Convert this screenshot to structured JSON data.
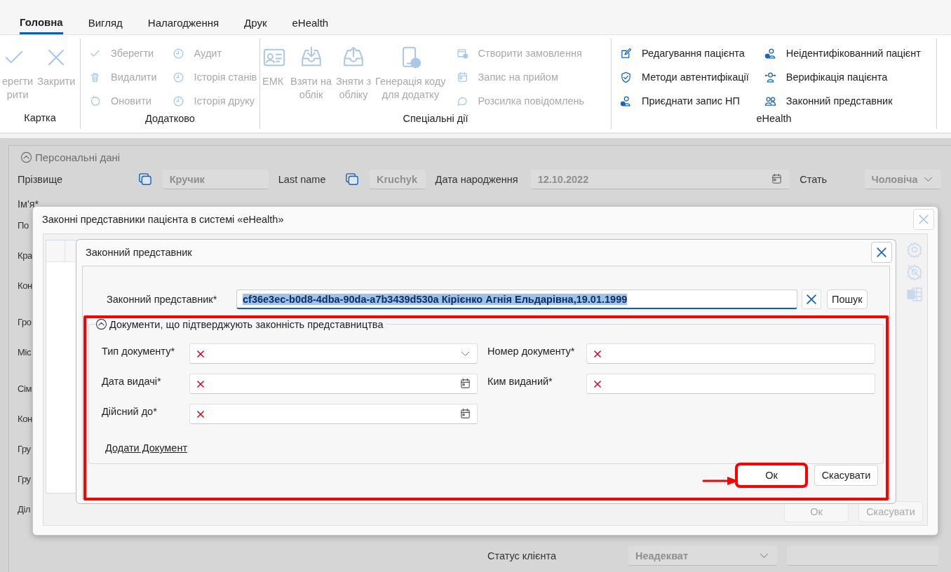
{
  "tabs": [
    {
      "label": "Головна",
      "selected": true
    },
    {
      "label": "Вигляд",
      "selected": false
    },
    {
      "label": "Налагодження",
      "selected": false
    },
    {
      "label": "Друк",
      "selected": false
    },
    {
      "label": "eHealth",
      "selected": false
    }
  ],
  "ribbon": {
    "groups": [
      {
        "title": "Картка",
        "items": [
          {
            "kind": "large",
            "lines": [
              "ерегти",
              "рити"
            ],
            "disabled": true
          },
          {
            "kind": "large",
            "lines": [
              "Закрити"
            ],
            "disabled": true
          }
        ]
      },
      {
        "title": "Додатково",
        "items": [
          {
            "kind": "small",
            "lines": [
              "Зберегти"
            ],
            "disabled": true
          },
          {
            "kind": "small",
            "lines": [
              "Видалити"
            ],
            "disabled": true
          },
          {
            "kind": "small",
            "lines": [
              "Оновити"
            ],
            "disabled": true
          },
          {
            "kind": "small",
            "lines": [
              "Аудит"
            ],
            "disabled": true
          },
          {
            "kind": "small",
            "lines": [
              "Історія станів"
            ],
            "disabled": true
          },
          {
            "kind": "small",
            "lines": [
              "Історія друку"
            ],
            "disabled": true
          }
        ]
      },
      {
        "title": "Спеціальні дії",
        "items": [
          {
            "kind": "large",
            "lines": [
              "ЕМК"
            ],
            "disabled": true
          },
          {
            "kind": "large",
            "lines": [
              "Взяти на",
              "облік"
            ],
            "disabled": true
          },
          {
            "kind": "large",
            "lines": [
              "Зняти з",
              "обліку"
            ],
            "disabled": true
          },
          {
            "kind": "large",
            "lines": [
              "Генерація коду",
              "для додатку"
            ],
            "disabled": true
          },
          {
            "kind": "small",
            "lines": [
              "Створити замовлення"
            ],
            "disabled": true
          },
          {
            "kind": "small",
            "lines": [
              "Запис на прийом"
            ],
            "disabled": true
          },
          {
            "kind": "small",
            "lines": [
              "Розсилка повідомлень"
            ],
            "disabled": true
          }
        ]
      },
      {
        "title": "eHealth",
        "items": [
          {
            "kind": "small",
            "lines": [
              "Редагування пацієнта"
            ],
            "disabled": false
          },
          {
            "kind": "small",
            "lines": [
              "Методи автентифікації"
            ],
            "disabled": false
          },
          {
            "kind": "small",
            "lines": [
              "Приєднати запис НП"
            ],
            "disabled": false
          },
          {
            "kind": "small",
            "lines": [
              "Неідентифікованний пацієнт"
            ],
            "disabled": false
          },
          {
            "kind": "small",
            "lines": [
              "Верифікація пацієнта"
            ],
            "disabled": false
          },
          {
            "kind": "small",
            "lines": [
              "Законний представник"
            ],
            "disabled": false
          }
        ]
      }
    ]
  },
  "personal_section": {
    "title": "Персональні дані",
    "expanded": true,
    "row_1": [
      {
        "label": "Прізвище",
        "kind": "copy-text",
        "value": "Кручик"
      },
      {
        "label": "Last name",
        "kind": "copy-text",
        "value": "Kruchyk"
      },
      {
        "label": "Дата народження",
        "kind": "date",
        "value": "12.10.2022"
      },
      {
        "label": "Стать",
        "kind": "dropdown",
        "value": "Чоловіча"
      }
    ],
    "row_2_labels": [
      "Ім'я*"
    ],
    "left_labels": [
      "По",
      "Кра",
      "Кон",
      "Гро",
      "Міс",
      "Сім",
      "Кон",
      "Гру",
      "Гру",
      "Діл"
    ],
    "client_status": {
      "label": "Статус клієнта",
      "value": "Неадекват"
    }
  },
  "representatives_dialog": {
    "title": "Законні представники пацієнта в системі «eHealth»",
    "table": {
      "header_visible": true
    },
    "buttons": [
      {
        "label": "Ок",
        "disabled": true
      },
      {
        "label": "Скасувати",
        "disabled": true
      }
    ]
  },
  "representative_dialog": {
    "title": "Законний представник",
    "representative": {
      "label": "Законний представник*",
      "value": "cf36e3ec-b0d8-4dba-90da-a7b3439d530a Кірієнко Агнія Ельдарівна,19.01.1999",
      "selected_text": true
    },
    "search_button": "Пошук",
    "documents_section": {
      "title": "Документи, що підтверджують законність представництва",
      "expanded": true,
      "highlighted": true,
      "fields": [
        {
          "label": "Тип документу*",
          "kind": "dropdown",
          "invalid": true
        },
        {
          "label": "Номер документу*",
          "kind": "text",
          "invalid": true
        },
        {
          "label": "Дата видачі*",
          "kind": "date",
          "invalid": true
        },
        {
          "label": "Ким виданий*",
          "kind": "text",
          "invalid": true
        },
        {
          "label": "Дійсний до*",
          "kind": "date",
          "invalid": true
        }
      ],
      "add_link": "Додати Документ"
    },
    "buttons": [
      {
        "label": "Ок",
        "highlighted": true
      },
      {
        "label": "Скасувати",
        "highlighted": false
      }
    ]
  }
}
